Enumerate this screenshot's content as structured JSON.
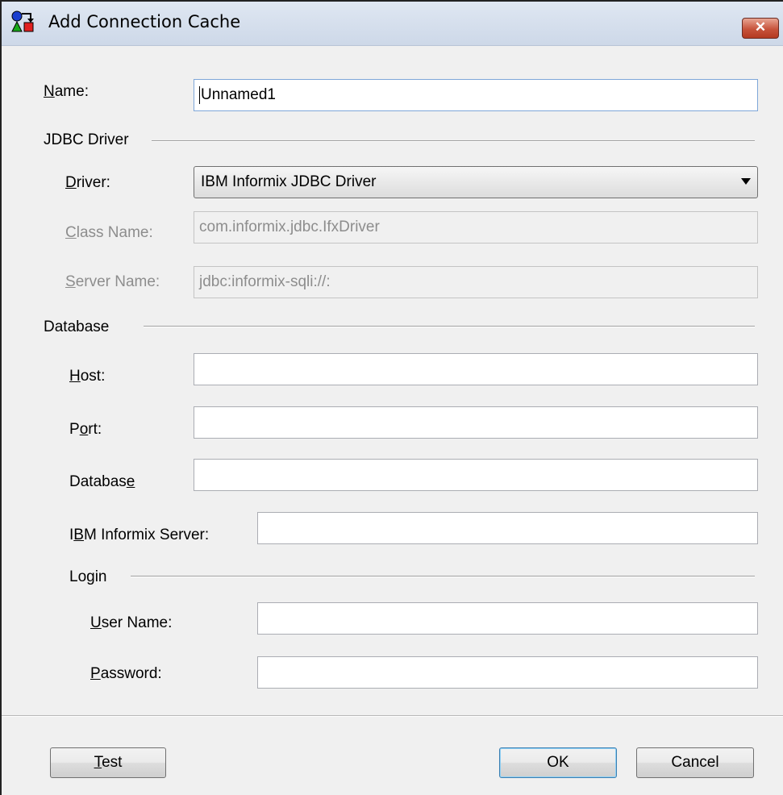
{
  "window": {
    "title": "Add Connection Cache",
    "close_label": "✕"
  },
  "name": {
    "label_u": "N",
    "label_rest": "ame:",
    "value": "Unnamed1"
  },
  "jdbc": {
    "heading": "JDBC Driver",
    "driver_label_u": "D",
    "driver_label_rest": "river:",
    "driver_value": "IBM Informix JDBC Driver",
    "class_label_u": "C",
    "class_label_rest": "lass Name:",
    "class_value": "com.informix.jdbc.IfxDriver",
    "server_label_u": "S",
    "server_label_rest": "erver Name:",
    "server_value": "jdbc:informix-sqli://:"
  },
  "database": {
    "heading": "Database",
    "host_label_u": "H",
    "host_label_rest": "ost:",
    "host_value": "",
    "port_label_pre": "P",
    "port_label_u": "o",
    "port_label_rest": "rt:",
    "port_value": "",
    "db_label_pre": "Databas",
    "db_label_u": "e",
    "db_value": "",
    "ifx_label_pre": "I",
    "ifx_label_u": "B",
    "ifx_label_rest": "M Informix Server:",
    "ifx_value": ""
  },
  "login": {
    "heading": "Login",
    "user_label_u": "U",
    "user_label_rest": "ser Name:",
    "user_value": "",
    "pass_label_u": "P",
    "pass_label_rest": "assword:",
    "pass_value": ""
  },
  "buttons": {
    "test_u": "T",
    "test_rest": "est",
    "ok": "OK",
    "cancel": "Cancel"
  }
}
